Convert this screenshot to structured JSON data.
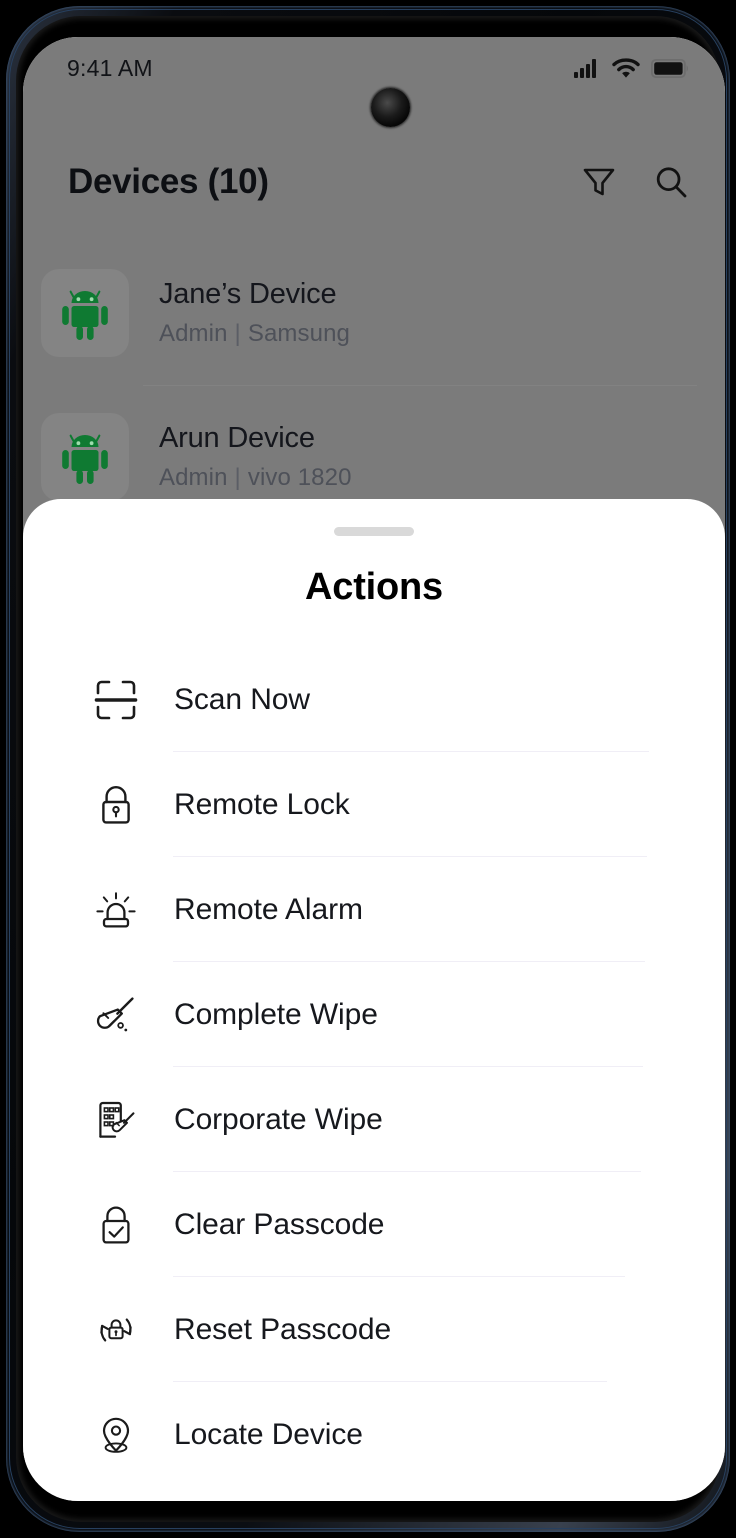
{
  "status_bar": {
    "time": "9:41 AM",
    "icons": [
      "cellular-signal-icon",
      "wifi-icon",
      "battery-icon"
    ]
  },
  "app": {
    "header": {
      "title": "Devices (10)",
      "actions": [
        {
          "name": "filter-icon",
          "label": "Filter"
        },
        {
          "name": "search-icon",
          "label": "Search"
        }
      ]
    },
    "devices": [
      {
        "name": "Jane’s Device",
        "role": "Admin",
        "separator": "|",
        "model": "Samsung",
        "icon": "android-robot-icon"
      },
      {
        "name": "Arun Device",
        "role": "Admin",
        "separator": "|",
        "model": "vivo 1820",
        "icon": "android-robot-icon"
      }
    ]
  },
  "sheet": {
    "title": "Actions",
    "handle": "drag-handle",
    "actions": [
      {
        "label": "Scan Now",
        "icon": "scan-frame-icon"
      },
      {
        "label": "Remote Lock",
        "icon": "padlock-icon"
      },
      {
        "label": "Remote Alarm",
        "icon": "siren-alarm-icon"
      },
      {
        "label": "Complete Wipe",
        "icon": "broom-icon"
      },
      {
        "label": "Corporate Wipe",
        "icon": "building-broom-icon"
      },
      {
        "label": "Clear Passcode",
        "icon": "lock-check-icon"
      },
      {
        "label": "Reset Passcode",
        "icon": "lock-refresh-icon"
      },
      {
        "label": "Locate Device",
        "icon": "location-pin-icon"
      }
    ]
  },
  "colors": {
    "android_green": "#0f7a32",
    "scrim": "#7b7b7b",
    "sheet_background": "#ffffff",
    "divider": "#f0eef6",
    "text_primary": "#16181d",
    "text_secondary": "#4e5159"
  }
}
